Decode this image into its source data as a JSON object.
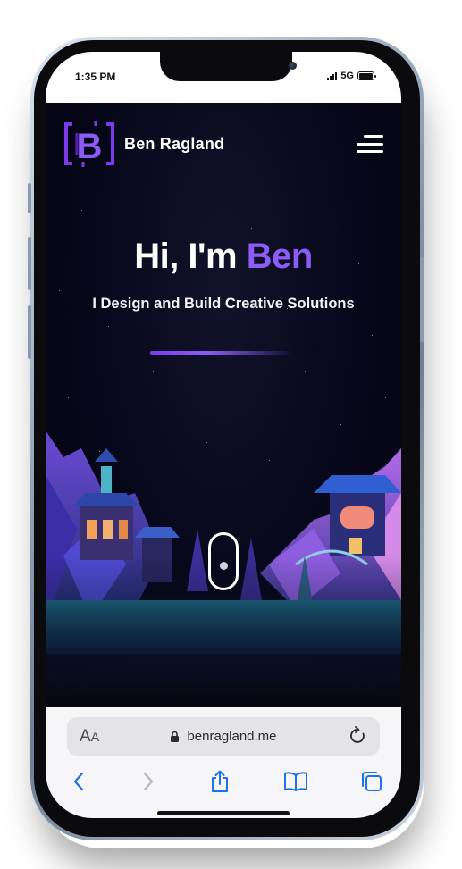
{
  "status_bar": {
    "time": "1:35 PM",
    "network": "5G"
  },
  "site": {
    "brand": "Ben Ragland",
    "logo_letter": "B",
    "hero_prefix": "Hi, I'm ",
    "hero_name": "Ben",
    "hero_subtitle": "I Design and Build Creative Solutions",
    "accent_color": "#8b5cf6"
  },
  "safari": {
    "text_size_label": "A",
    "text_size_label_small": "A",
    "url": "benragland.me",
    "toolbar_icons": [
      "back-icon",
      "forward-icon",
      "share-icon",
      "bookmarks-icon",
      "tabs-icon"
    ]
  }
}
